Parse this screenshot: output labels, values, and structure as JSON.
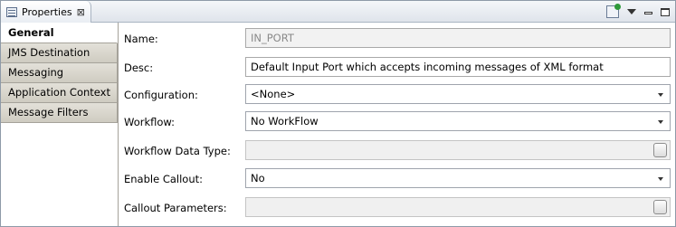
{
  "tab": {
    "title": "Properties",
    "close_glyph": "⊠",
    "icon": "properties-view-icon"
  },
  "toolbar": {
    "pin_icon": "pin-editor-icon",
    "menu_icon": "view-menu-icon",
    "minimize_icon": "minimize-icon",
    "maximize_icon": "maximize-icon"
  },
  "sidebar": {
    "items": [
      {
        "label": "General",
        "active": true
      },
      {
        "label": "JMS Destination",
        "active": false
      },
      {
        "label": "Messaging",
        "active": false
      },
      {
        "label": "Application Context",
        "active": false
      },
      {
        "label": "Message Filters",
        "active": false
      }
    ]
  },
  "form": {
    "name": {
      "label": "Name:",
      "value": "IN_PORT"
    },
    "desc": {
      "label": "Desc:",
      "value": "Default Input Port which accepts incoming messages of XML format"
    },
    "configuration": {
      "label": "Configuration:",
      "value": "<None>"
    },
    "workflow": {
      "label": "Workflow:",
      "value": "No WorkFlow"
    },
    "workflow_data_type": {
      "label": "Workflow Data Type:",
      "value": ""
    },
    "enable_callout": {
      "label": "Enable Callout:",
      "value": "No"
    },
    "callout_parameters": {
      "label": "Callout Parameters:",
      "value": ""
    }
  }
}
